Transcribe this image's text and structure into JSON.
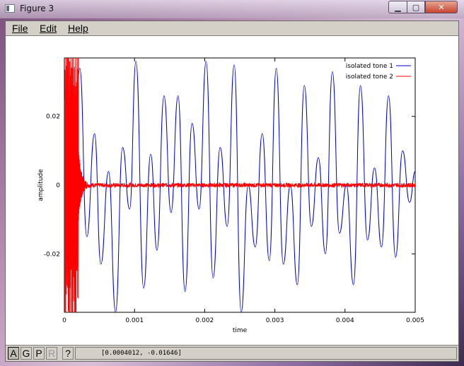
{
  "window": {
    "title": "Figure 3",
    "min_label": "▁",
    "max_label": "▢",
    "close_label": "✕"
  },
  "menu": [
    {
      "label": "File"
    },
    {
      "label": "Edit"
    },
    {
      "label": "Help"
    }
  ],
  "toolbar": {
    "buttons": [
      {
        "label": "A",
        "active": true
      },
      {
        "label": "G"
      },
      {
        "label": "P"
      },
      {
        "label": "R",
        "disabled": true
      },
      {
        "label": "?"
      }
    ]
  },
  "status": {
    "coordinates": "[0.0004012, -0.01646]"
  },
  "chart_data": {
    "type": "line",
    "title": "",
    "xlabel": "time",
    "ylabel": "amplitude",
    "xlim": [
      0,
      0.005
    ],
    "ylim": [
      -0.037,
      0.037
    ],
    "xticks": [
      0,
      0.001,
      0.002,
      0.003,
      0.004,
      0.005
    ],
    "xtick_labels": [
      "0",
      "0.001",
      "0.002",
      "0.003",
      "0.004",
      "0.005"
    ],
    "yticks": [
      -0.02,
      0,
      0.02
    ],
    "ytick_labels": [
      "-0.02",
      "0",
      "0.02"
    ],
    "legend_position": "top-right",
    "series": [
      {
        "name": "isolated tone 1",
        "color": "#0000cc",
        "x": [
          0.00012,
          0.00022,
          0.00032,
          0.00043,
          0.00052,
          0.00063,
          0.00073,
          0.00083,
          0.00093,
          0.00102,
          0.00113,
          0.00123,
          0.00132,
          0.00142,
          0.00152,
          0.00162,
          0.00172,
          0.00182,
          0.00192,
          0.00202,
          0.00212,
          0.00222,
          0.00232,
          0.00242,
          0.00252,
          0.00262,
          0.00272,
          0.00282,
          0.00292,
          0.00302,
          0.00312,
          0.00322,
          0.00332,
          0.00342,
          0.00352,
          0.00362,
          0.00372,
          0.00382,
          0.00392,
          0.00402,
          0.00412,
          0.00422,
          0.00432,
          0.00442,
          0.00452,
          0.00462,
          0.00472,
          0.00482,
          0.00492,
          0.005
        ],
        "y": [
          0.0,
          0.034,
          -0.015,
          0.015,
          -0.023,
          0.004,
          -0.037,
          0.011,
          -0.007,
          0.036,
          -0.03,
          0.009,
          -0.019,
          0.026,
          -0.008,
          0.026,
          -0.031,
          0.018,
          -0.007,
          0.036,
          -0.027,
          0.011,
          -0.012,
          0.035,
          -0.037,
          0.0,
          -0.018,
          0.015,
          -0.022,
          0.034,
          -0.023,
          0.0,
          -0.029,
          0.029,
          -0.012,
          0.008,
          -0.02,
          0.033,
          -0.014,
          0.0,
          -0.029,
          0.029,
          -0.016,
          0.005,
          -0.018,
          0.026,
          -0.021,
          0.01,
          -0.005,
          0.004
        ],
        "note_source": "visually estimated peaks/troughs"
      },
      {
        "name": "isolated tone 2",
        "color": "#ff0000",
        "burst_end": 0.0002,
        "burst_amplitude": 0.037,
        "noise_amplitude": 0.0006
      }
    ]
  }
}
